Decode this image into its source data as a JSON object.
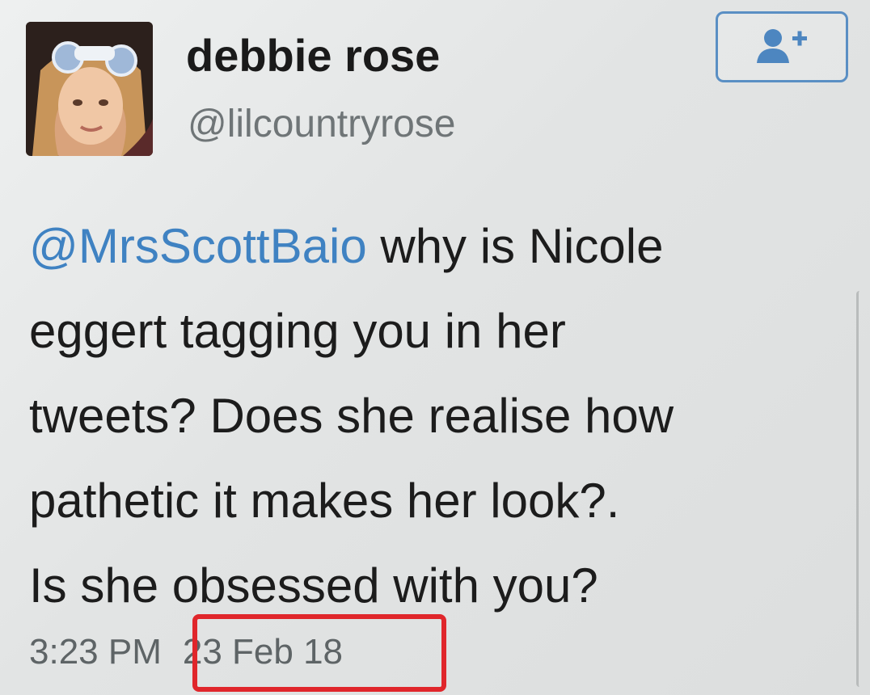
{
  "tweet": {
    "display_name": "debbie rose",
    "handle": "@lilcountryrose",
    "mention": "@MrsScottBaio",
    "text_lines": [
      " why is Nicole",
      "eggert tagging you in her",
      "tweets? Does she realise how",
      "pathetic it makes her look?.",
      "Is she obsessed with you?"
    ],
    "time": "3:23 PM",
    "date": "23 Feb 18"
  },
  "colors": {
    "mention": "#3f82c2",
    "follow_border": "#5a8fc4",
    "highlight": "#e0262b"
  },
  "icons": {
    "follow": "add-user-icon"
  }
}
